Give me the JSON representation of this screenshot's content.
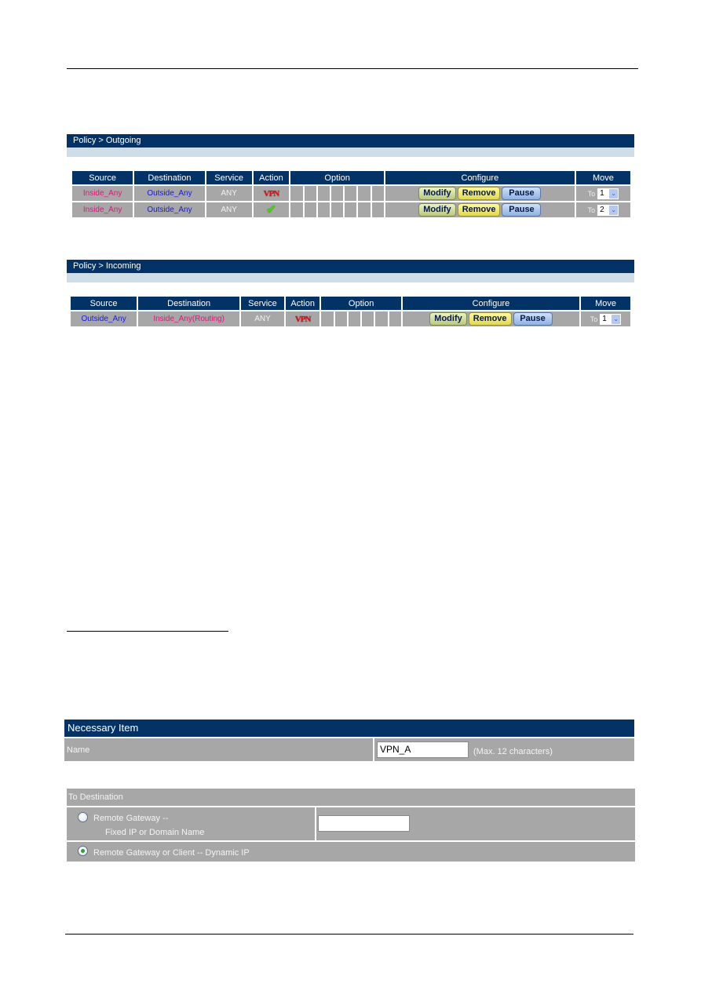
{
  "outgoing": {
    "title": "Policy > Outgoing",
    "headers": {
      "source": "Source",
      "destination": "Destination",
      "service": "Service",
      "action": "Action",
      "option": "Option",
      "configure": "Configure",
      "move": "Move"
    },
    "rows": [
      {
        "source": "Inside_Any",
        "destination": "Outside_Any",
        "service": "ANY",
        "action": "VPN",
        "move_label": "To",
        "move_value": "1"
      },
      {
        "source": "Inside_Any",
        "destination": "Outside_Any",
        "service": "ANY",
        "action": "✔",
        "move_label": "To",
        "move_value": "2"
      }
    ]
  },
  "incoming": {
    "title": "Policy > Incoming",
    "headers": {
      "source": "Source",
      "destination": "Destination",
      "service": "Service",
      "action": "Action",
      "option": "Option",
      "configure": "Configure",
      "move": "Move"
    },
    "rows": [
      {
        "source": "Outside_Any",
        "destination": "Inside_Any(Routing)",
        "service": "ANY",
        "action": "VPN",
        "move_label": "To",
        "move_value": "1"
      }
    ]
  },
  "buttons": {
    "modify": "Modify",
    "remove": "Remove",
    "pause": "Pause",
    "dropdown_arrow": "⌄"
  },
  "necessary": {
    "title": "Necessary Item",
    "name_label": "Name",
    "name_value": "VPN_A",
    "name_hint": "(Max. 12 characters)"
  },
  "destination": {
    "title": "To Destination",
    "option1_line1": "Remote Gateway --",
    "option1_line2": "Fixed IP or Domain Name",
    "option1_value": "",
    "option2": "Remote Gateway or Client -- Dynamic IP",
    "selected": "option2"
  }
}
